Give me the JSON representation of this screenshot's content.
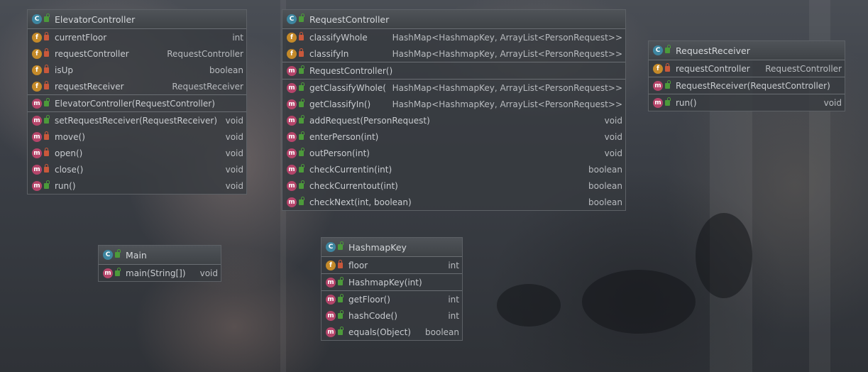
{
  "classes": {
    "elevator_controller": {
      "name": "ElevatorController",
      "fields": [
        {
          "name": "currentFloor",
          "type": "int"
        },
        {
          "name": "requestController",
          "type": "RequestController"
        },
        {
          "name": "isUp",
          "type": "boolean"
        },
        {
          "name": "requestReceiver",
          "type": "RequestReceiver"
        }
      ],
      "constructors": [
        {
          "name": "ElevatorController(RequestController)"
        }
      ],
      "methods": [
        {
          "name": "setRequestReceiver(RequestReceiver)",
          "type": "void"
        },
        {
          "name": "move()",
          "type": "void"
        },
        {
          "name": "open()",
          "type": "void"
        },
        {
          "name": "close()",
          "type": "void"
        },
        {
          "name": "run()",
          "type": "void"
        }
      ]
    },
    "request_controller": {
      "name": "RequestController",
      "fields": [
        {
          "name": "classifyWhole",
          "type": "HashMap<HashmapKey, ArrayList<PersonRequest>>"
        },
        {
          "name": "classifyIn",
          "type": "HashMap<HashmapKey, ArrayList<PersonRequest>>"
        }
      ],
      "constructors": [
        {
          "name": "RequestController()"
        }
      ],
      "methods": [
        {
          "name": "getClassifyWhole()",
          "type": "HashMap<HashmapKey, ArrayList<PersonRequest>>"
        },
        {
          "name": "getClassifyIn()",
          "type": "HashMap<HashmapKey, ArrayList<PersonRequest>>"
        },
        {
          "name": "addRequest(PersonRequest)",
          "type": "void"
        },
        {
          "name": "enterPerson(int)",
          "type": "void"
        },
        {
          "name": "outPerson(int)",
          "type": "void"
        },
        {
          "name": "checkCurrentin(int)",
          "type": "boolean"
        },
        {
          "name": "checkCurrentout(int)",
          "type": "boolean"
        },
        {
          "name": "checkNext(int, boolean)",
          "type": "boolean"
        }
      ]
    },
    "request_receiver": {
      "name": "RequestReceiver",
      "fields": [
        {
          "name": "requestController",
          "type": "RequestController"
        }
      ],
      "constructors": [
        {
          "name": "RequestReceiver(RequestController)"
        }
      ],
      "methods": [
        {
          "name": "run()",
          "type": "void"
        }
      ]
    },
    "main": {
      "name": "Main",
      "methods": [
        {
          "name": "main(String[])",
          "type": "void"
        }
      ]
    },
    "hashmap_key": {
      "name": "HashmapKey",
      "fields": [
        {
          "name": "floor",
          "type": "int"
        }
      ],
      "constructors": [
        {
          "name": "HashmapKey(int)"
        }
      ],
      "methods": [
        {
          "name": "getFloor()",
          "type": "int"
        },
        {
          "name": "hashCode()",
          "type": "int"
        },
        {
          "name": "equals(Object)",
          "type": "boolean"
        }
      ]
    }
  },
  "icons": {
    "class": "C",
    "field": "f",
    "method": "m"
  },
  "colors": {
    "class_icon": "#3e86a0",
    "field_icon": "#c48a2a",
    "method_icon": "#b5456a",
    "public_lock": "#4c9a3a",
    "private_lock": "#c9583b"
  }
}
